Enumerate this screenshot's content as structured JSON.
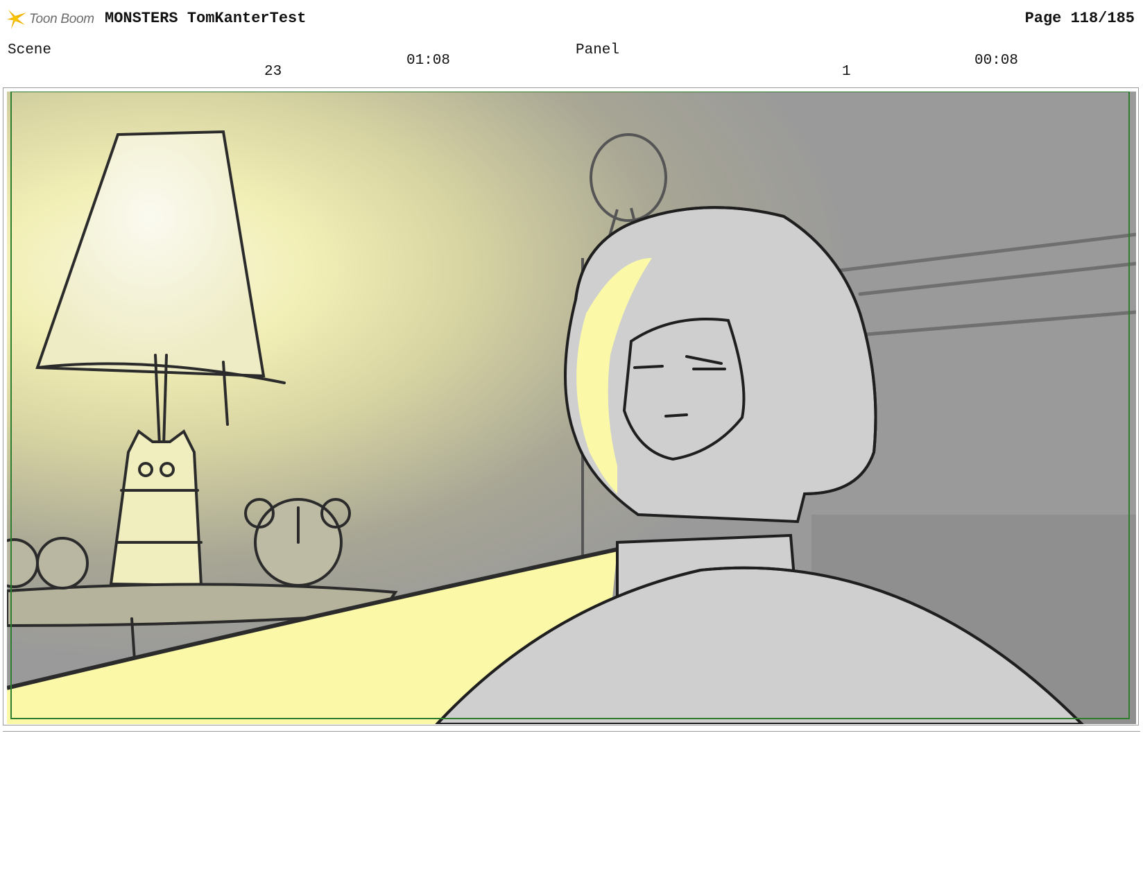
{
  "header": {
    "logo_text": "Toon Boom",
    "project_title": "MONSTERS TomKanterTest",
    "page": "Page 118/185"
  },
  "scene": {
    "label": "Scene",
    "number": "23",
    "duration": "01:08"
  },
  "panel": {
    "label": "Panel",
    "number": "1",
    "duration": "00:08"
  },
  "colors": {
    "safe_frame": "#2e7d2e",
    "lamp_glow": "#f6f4c8",
    "wall_gray": "#9a9a9a",
    "character_fill": "#cfcfcf",
    "rim_light": "#fbf8a8"
  }
}
